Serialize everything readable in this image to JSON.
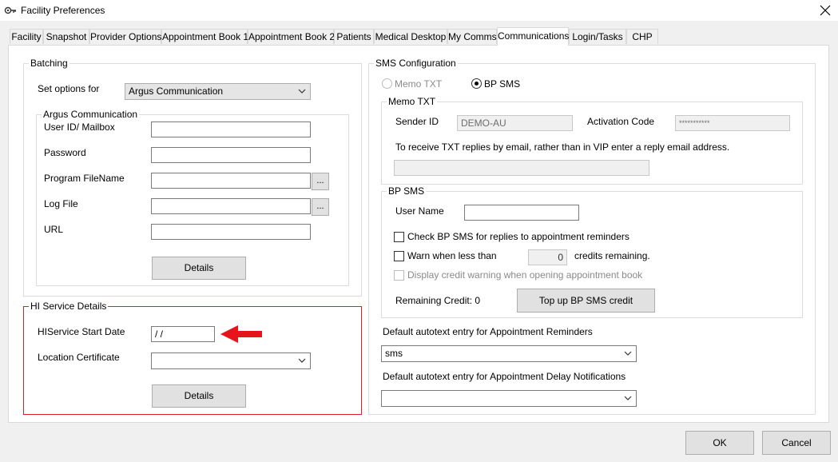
{
  "window": {
    "title": "Facility Preferences"
  },
  "tabs": [
    "Facility",
    "Snapshot",
    "Provider Options",
    "Appointment Book 1",
    "Appointment Book 2",
    "Patients",
    "Medical Desktop",
    "My Comms",
    "Communications",
    "Login/Tasks",
    "CHP"
  ],
  "active_tab": "Communications",
  "batching": {
    "legend": "Batching",
    "set_options_label": "Set options for",
    "set_options_value": "Argus Communication",
    "argus": {
      "legend": "Argus Communication",
      "user_label": "User ID/ Mailbox",
      "password_label": "Password",
      "program_label": "Program FileName",
      "log_label": "Log File",
      "url_label": "URL",
      "browse_label": "...",
      "details_label": "Details"
    }
  },
  "hi_service": {
    "legend": "HI Service Details",
    "start_date_label": "HIService Start Date",
    "start_date_value": "/  /",
    "location_label": "Location Certificate",
    "details_label": "Details"
  },
  "sms": {
    "legend": "SMS Configuration",
    "memo_radio_label": "Memo TXT",
    "bp_radio_label": "BP SMS",
    "selected": "BP SMS",
    "memo": {
      "legend": "Memo TXT",
      "sender_label": "Sender ID",
      "sender_value": "DEMO-AU",
      "activation_label": "Activation Code",
      "activation_value": "***********",
      "reply_text": "To receive TXT replies by email, rather than in VIP enter a reply email address."
    },
    "bp": {
      "legend": "BP SMS",
      "user_label": "User Name",
      "check_replies_label": "Check BP SMS for replies to appointment reminders",
      "warn_label": "Warn when less than",
      "warn_value": "0",
      "credits_label": "credits remaining.",
      "display_warning_label": "Display credit warning when opening appointment book",
      "remaining_label": "Remaining Credit: 0",
      "topup_label": "Top up BP SMS credit"
    },
    "reminders_label": "Default autotext entry for Appointment Reminders",
    "reminders_value": "sms",
    "delay_label": "Default autotext entry for Appointment Delay Notifications",
    "delay_value": ""
  },
  "buttons": {
    "ok": "OK",
    "cancel": "Cancel"
  },
  "colors": {
    "highlight_border": "#e02020",
    "arrow": "#e8141c"
  }
}
